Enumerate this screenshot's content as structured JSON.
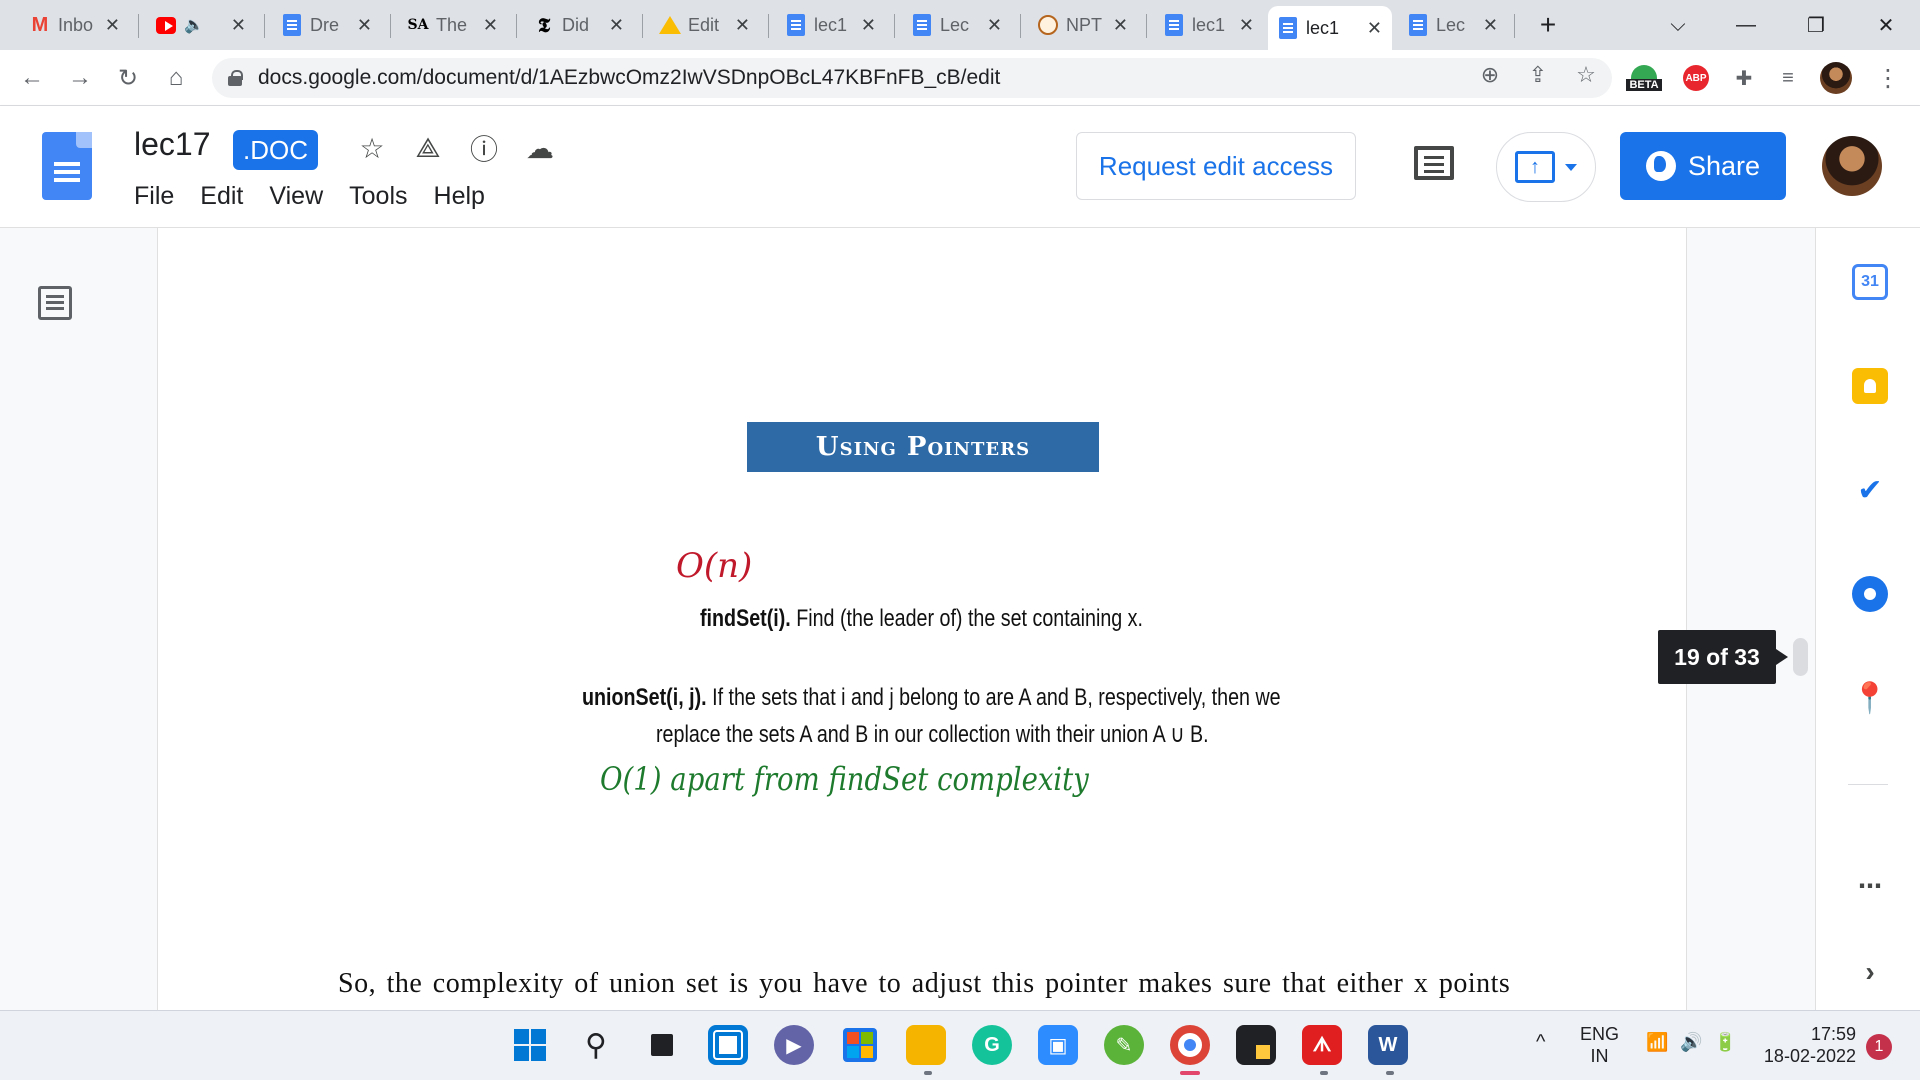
{
  "browser": {
    "tabs": [
      {
        "title": "Inbo",
        "icon": "gmail-icon",
        "active": false
      },
      {
        "title": "",
        "icon": "youtube-icon",
        "audio": true,
        "active": false
      },
      {
        "title": "Dre",
        "icon": "docs-icon",
        "active": false
      },
      {
        "title": "The",
        "icon": "sa-icon",
        "active": false
      },
      {
        "title": "Did",
        "icon": "nyt-icon",
        "active": false
      },
      {
        "title": "Edit",
        "icon": "drive-icon",
        "active": false
      },
      {
        "title": "lec1",
        "icon": "docs-icon",
        "active": false
      },
      {
        "title": "Lec",
        "icon": "docs-icon",
        "active": false
      },
      {
        "title": "NPT",
        "icon": "nptel-icon",
        "active": false
      },
      {
        "title": "lec1",
        "icon": "docs-icon",
        "active": false
      },
      {
        "title": "lec1",
        "icon": "docs-icon",
        "active": true
      },
      {
        "title": "Lec",
        "icon": "docs-icon",
        "active": false
      }
    ],
    "new_tab": "+",
    "url": "docs.google.com/document/d/1AEzbwcOmz2IwVSDnpOBcL47KBFnFB_cB/edit",
    "beta_label": "BETA",
    "abp_label": "ABP"
  },
  "docs": {
    "title": "lec17",
    "badge": ".DOC",
    "menu": [
      "File",
      "Edit",
      "View",
      "Tools",
      "Help"
    ],
    "request_edit": "Request edit access",
    "share": "Share",
    "present_arrow": "↑"
  },
  "content": {
    "slide_title": "Using Pointers",
    "hw_red": "O(n)",
    "findset_bold": "findSet(i).",
    "findset_text": " Find (the leader of) the set containing x.",
    "unionset_bold": "unionSet(i, j).",
    "unionset_text1": " If the sets that i and j belong to are A and B, respectively, then we",
    "unionset_text2": "replace the sets A and B in our collection with their union A ∪ B.",
    "hw_green": "O(1) apart from findSet complexity",
    "transcript": "So, the complexity of union set is you have to adjust this pointer makes sure that either x points",
    "page_indicator": "19 of 33"
  },
  "side_panel": {
    "calendar_day": "31"
  },
  "taskbar": {
    "lang_top": "ENG",
    "lang_bottom": "IN",
    "time": "17:59",
    "date": "18-02-2022",
    "notifications": "1"
  }
}
